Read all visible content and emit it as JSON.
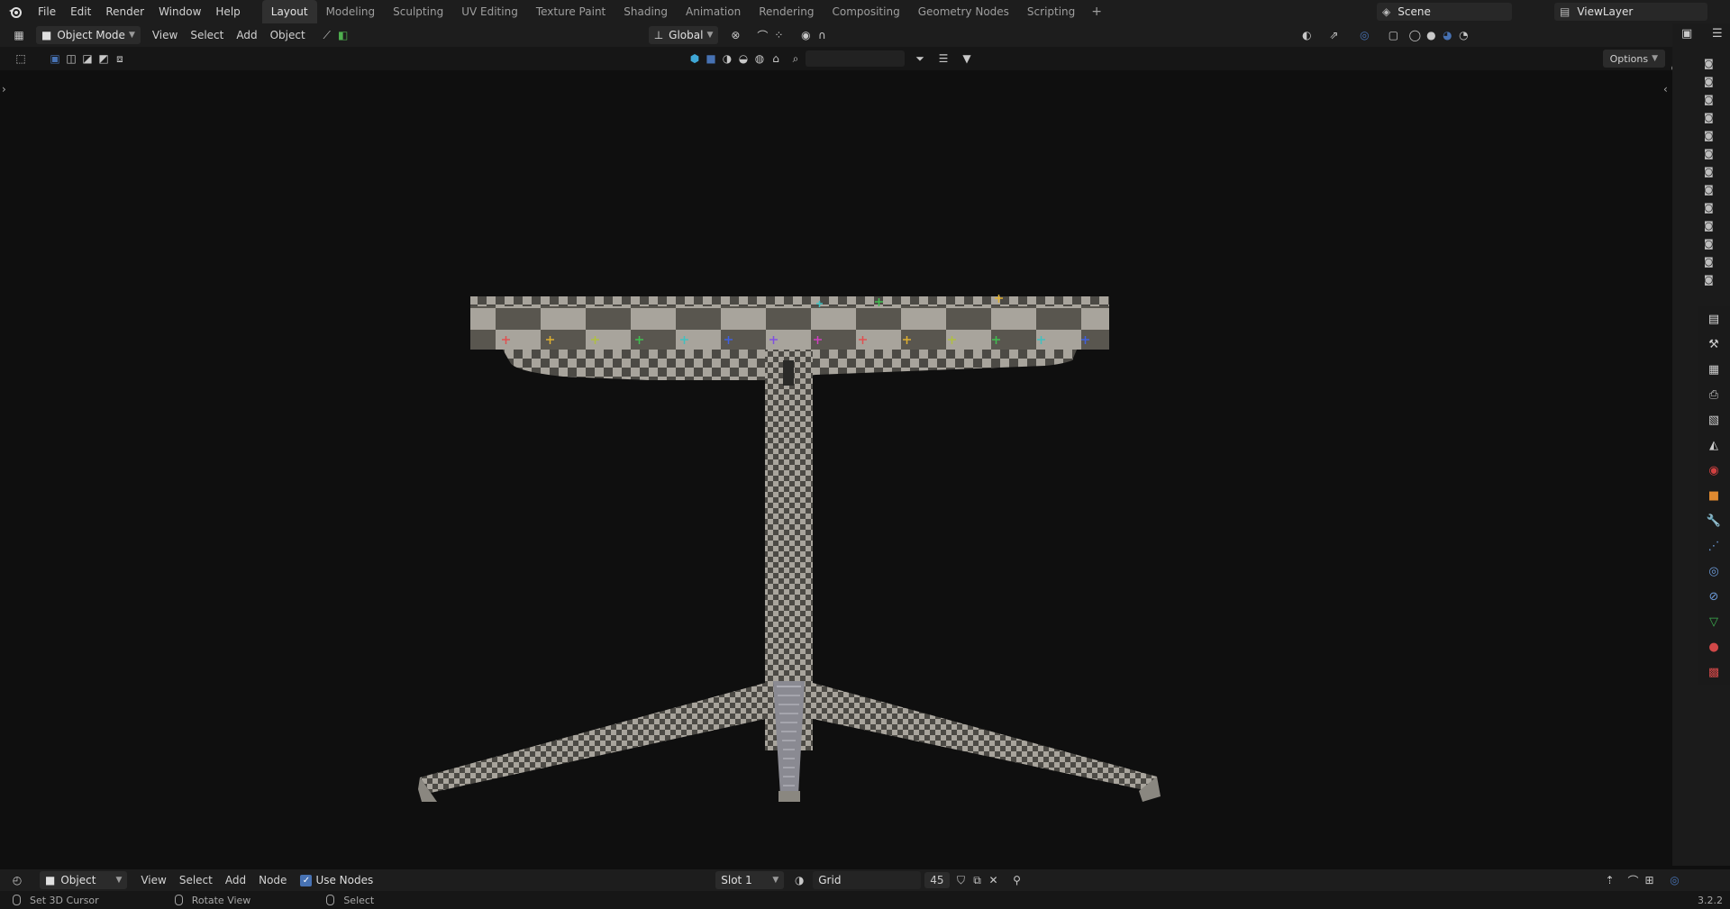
{
  "app": {
    "version": "3.2.2"
  },
  "topbar": {
    "menus": [
      "File",
      "Edit",
      "Render",
      "Window",
      "Help"
    ],
    "workspaces": [
      "Layout",
      "Modeling",
      "Sculpting",
      "UV Editing",
      "Texture Paint",
      "Shading",
      "Animation",
      "Rendering",
      "Compositing",
      "Geometry Nodes",
      "Scripting"
    ],
    "active_workspace": "Layout",
    "scene": "Scene",
    "view_layer": "ViewLayer"
  },
  "header": {
    "mode": "Object Mode",
    "menus": [
      "View",
      "Select",
      "Add",
      "Object"
    ],
    "transform_orientation": "Global"
  },
  "toolbar": {
    "options_label": "Options"
  },
  "bottom_editor": {
    "editor_mode": "Object",
    "menus": [
      "View",
      "Select",
      "Add",
      "Node"
    ],
    "use_nodes_label": "Use Nodes",
    "use_nodes_checked": true,
    "slot": "Slot 1",
    "material_name": "Grid",
    "user_count": "45"
  },
  "statusbar": {
    "left": "Set 3D Cursor",
    "middle": "Rotate View",
    "right": "Select"
  },
  "colors": {
    "accent": "#4772b3",
    "viewport_bg": "#0f0f0f",
    "header_bg": "#1d1d1d"
  }
}
